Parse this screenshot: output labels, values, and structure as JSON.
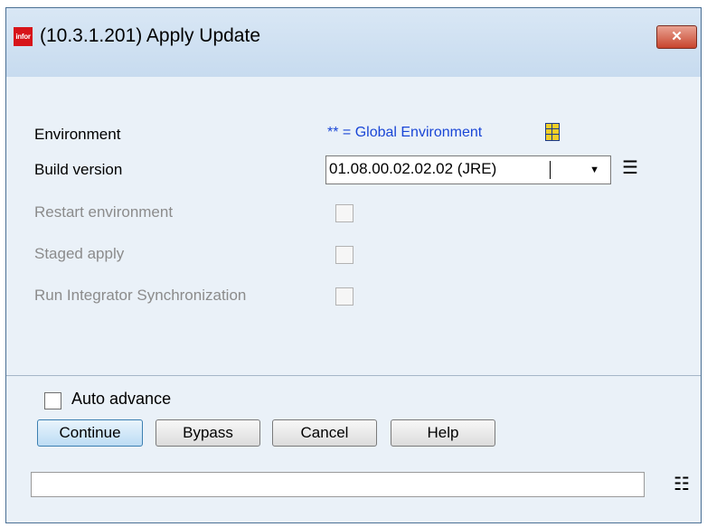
{
  "window": {
    "logo_text": "infor",
    "title": "(10.3.1.201) Apply Update",
    "close_symbol": "✕"
  },
  "form": {
    "environment_label": "Environment",
    "environment_value": "** = Global Environment",
    "environment_icon": "grid-icon",
    "build_version_label": "Build version",
    "build_version_value": "01.08.00.02.02.02  (JRE)",
    "build_dropdown_arrow": "▼",
    "list_icon_glyph": "☰",
    "restart_label": "Restart environment",
    "staged_label": "Staged apply",
    "run_sync_label": "Run Integrator Synchronization"
  },
  "footer": {
    "auto_advance_label": "Auto advance",
    "buttons": {
      "continue": "Continue",
      "bypass": "Bypass",
      "cancel": "Cancel",
      "help": "Help"
    },
    "status_text": "",
    "status_icon_glyph": "☷"
  },
  "colors": {
    "title_bar": "#c7dbef",
    "window_bg": "#eaf1f8",
    "link_blue": "#1a46d6",
    "close_red": "#c8442d",
    "logo_red": "#d7141a"
  }
}
